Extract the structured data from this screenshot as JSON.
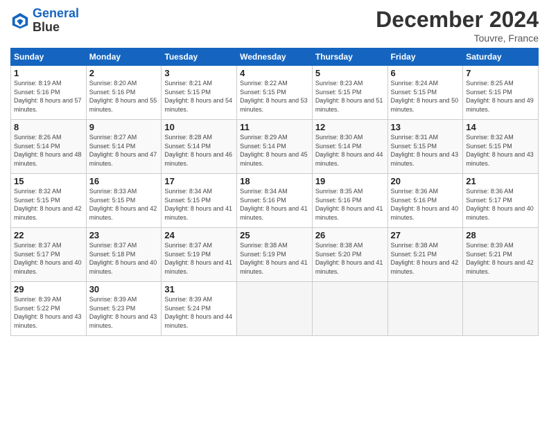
{
  "header": {
    "logo_line1": "General",
    "logo_line2": "Blue",
    "month": "December 2024",
    "location": "Touvre, France"
  },
  "days_of_week": [
    "Sunday",
    "Monday",
    "Tuesday",
    "Wednesday",
    "Thursday",
    "Friday",
    "Saturday"
  ],
  "weeks": [
    [
      {
        "num": "1",
        "sunrise": "8:19 AM",
        "sunset": "5:16 PM",
        "daylight": "8 hours and 57 minutes."
      },
      {
        "num": "2",
        "sunrise": "8:20 AM",
        "sunset": "5:16 PM",
        "daylight": "8 hours and 55 minutes."
      },
      {
        "num": "3",
        "sunrise": "8:21 AM",
        "sunset": "5:15 PM",
        "daylight": "8 hours and 54 minutes."
      },
      {
        "num": "4",
        "sunrise": "8:22 AM",
        "sunset": "5:15 PM",
        "daylight": "8 hours and 53 minutes."
      },
      {
        "num": "5",
        "sunrise": "8:23 AM",
        "sunset": "5:15 PM",
        "daylight": "8 hours and 51 minutes."
      },
      {
        "num": "6",
        "sunrise": "8:24 AM",
        "sunset": "5:15 PM",
        "daylight": "8 hours and 50 minutes."
      },
      {
        "num": "7",
        "sunrise": "8:25 AM",
        "sunset": "5:15 PM",
        "daylight": "8 hours and 49 minutes."
      }
    ],
    [
      {
        "num": "8",
        "sunrise": "8:26 AM",
        "sunset": "5:14 PM",
        "daylight": "8 hours and 48 minutes."
      },
      {
        "num": "9",
        "sunrise": "8:27 AM",
        "sunset": "5:14 PM",
        "daylight": "8 hours and 47 minutes."
      },
      {
        "num": "10",
        "sunrise": "8:28 AM",
        "sunset": "5:14 PM",
        "daylight": "8 hours and 46 minutes."
      },
      {
        "num": "11",
        "sunrise": "8:29 AM",
        "sunset": "5:14 PM",
        "daylight": "8 hours and 45 minutes."
      },
      {
        "num": "12",
        "sunrise": "8:30 AM",
        "sunset": "5:14 PM",
        "daylight": "8 hours and 44 minutes."
      },
      {
        "num": "13",
        "sunrise": "8:31 AM",
        "sunset": "5:15 PM",
        "daylight": "8 hours and 43 minutes."
      },
      {
        "num": "14",
        "sunrise": "8:32 AM",
        "sunset": "5:15 PM",
        "daylight": "8 hours and 43 minutes."
      }
    ],
    [
      {
        "num": "15",
        "sunrise": "8:32 AM",
        "sunset": "5:15 PM",
        "daylight": "8 hours and 42 minutes."
      },
      {
        "num": "16",
        "sunrise": "8:33 AM",
        "sunset": "5:15 PM",
        "daylight": "8 hours and 42 minutes."
      },
      {
        "num": "17",
        "sunrise": "8:34 AM",
        "sunset": "5:15 PM",
        "daylight": "8 hours and 41 minutes."
      },
      {
        "num": "18",
        "sunrise": "8:34 AM",
        "sunset": "5:16 PM",
        "daylight": "8 hours and 41 minutes."
      },
      {
        "num": "19",
        "sunrise": "8:35 AM",
        "sunset": "5:16 PM",
        "daylight": "8 hours and 41 minutes."
      },
      {
        "num": "20",
        "sunrise": "8:36 AM",
        "sunset": "5:16 PM",
        "daylight": "8 hours and 40 minutes."
      },
      {
        "num": "21",
        "sunrise": "8:36 AM",
        "sunset": "5:17 PM",
        "daylight": "8 hours and 40 minutes."
      }
    ],
    [
      {
        "num": "22",
        "sunrise": "8:37 AM",
        "sunset": "5:17 PM",
        "daylight": "8 hours and 40 minutes."
      },
      {
        "num": "23",
        "sunrise": "8:37 AM",
        "sunset": "5:18 PM",
        "daylight": "8 hours and 40 minutes."
      },
      {
        "num": "24",
        "sunrise": "8:37 AM",
        "sunset": "5:19 PM",
        "daylight": "8 hours and 41 minutes."
      },
      {
        "num": "25",
        "sunrise": "8:38 AM",
        "sunset": "5:19 PM",
        "daylight": "8 hours and 41 minutes."
      },
      {
        "num": "26",
        "sunrise": "8:38 AM",
        "sunset": "5:20 PM",
        "daylight": "8 hours and 41 minutes."
      },
      {
        "num": "27",
        "sunrise": "8:38 AM",
        "sunset": "5:21 PM",
        "daylight": "8 hours and 42 minutes."
      },
      {
        "num": "28",
        "sunrise": "8:39 AM",
        "sunset": "5:21 PM",
        "daylight": "8 hours and 42 minutes."
      }
    ],
    [
      {
        "num": "29",
        "sunrise": "8:39 AM",
        "sunset": "5:22 PM",
        "daylight": "8 hours and 43 minutes."
      },
      {
        "num": "30",
        "sunrise": "8:39 AM",
        "sunset": "5:23 PM",
        "daylight": "8 hours and 43 minutes."
      },
      {
        "num": "31",
        "sunrise": "8:39 AM",
        "sunset": "5:24 PM",
        "daylight": "8 hours and 44 minutes."
      },
      null,
      null,
      null,
      null
    ]
  ]
}
